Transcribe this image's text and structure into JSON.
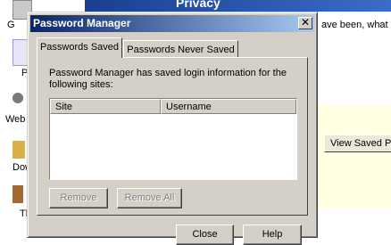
{
  "background": {
    "privacy_title": "Privacy",
    "left_labels": [
      "G",
      "P",
      "Web",
      "Dow",
      "Tl"
    ],
    "right_text": "ave been, what",
    "view_saved_label": "View Saved Pa"
  },
  "dialog": {
    "title": "Password Manager",
    "close_glyph": "✕",
    "tabs": [
      {
        "label": "Passwords Saved",
        "active": true
      },
      {
        "label": "Passwords Never Saved",
        "active": false
      }
    ],
    "description": "Password Manager has saved login information for the following sites:",
    "columns": [
      "Site",
      "Username"
    ],
    "rows": [],
    "buttons": {
      "remove": "Remove",
      "remove_all": "Remove All",
      "close": "Close",
      "help": "Help"
    }
  }
}
